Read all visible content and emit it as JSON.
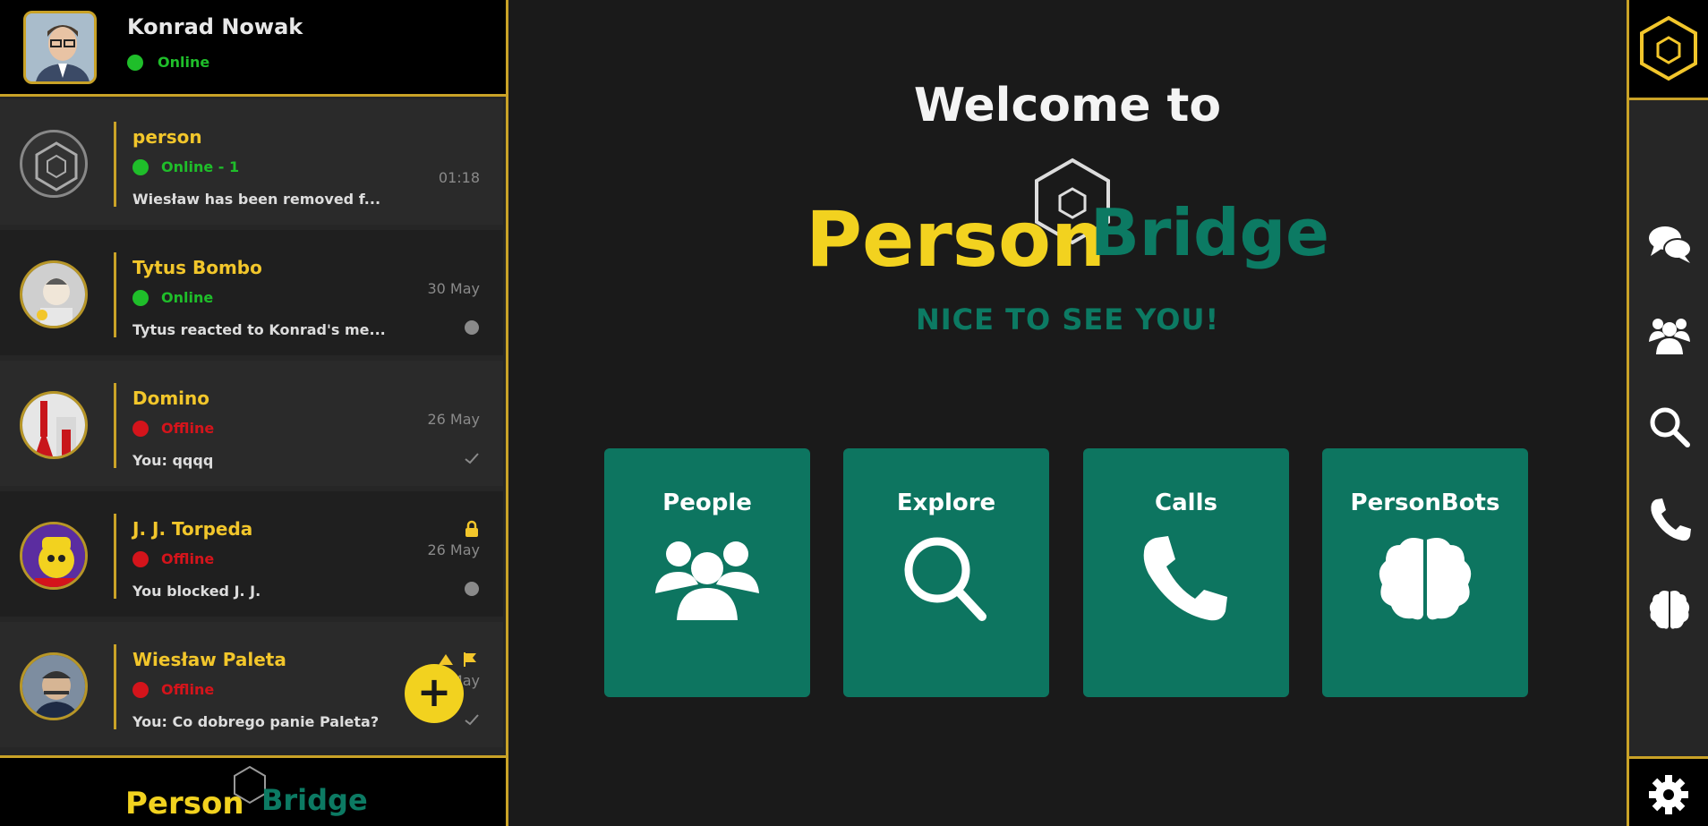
{
  "user": {
    "name": "Konrad Nowak",
    "status": "Online"
  },
  "chats": [
    {
      "name": "person",
      "status": "Online - 1",
      "status_color": "#1fbe2a",
      "message": "Wiesław has been removed f...",
      "time": "01:18"
    },
    {
      "name": "Tytus Bombo",
      "status": "Online",
      "status_color": "#1fbe2a",
      "message": "Tytus reacted to Konrad's me...",
      "time": "30 May"
    },
    {
      "name": "Domino",
      "status": "Offline",
      "status_color": "#d4141b",
      "message": "You: qqqq",
      "time": "26 May"
    },
    {
      "name": "J. J. Torpeda",
      "status": "Offline",
      "status_color": "#d4141b",
      "message": "You blocked J. J.",
      "time": "26 May"
    },
    {
      "name": "Wiesław Paleta",
      "status": "Offline",
      "status_color": "#d4141b",
      "message": "You: Co dobrego panie Paleta?",
      "time": "May"
    }
  ],
  "main": {
    "welcome": "Welcome to",
    "brand_left": "Person",
    "brand_right": "Bridge",
    "subtitle": "NICE TO SEE YOU!",
    "tiles": [
      {
        "label": "People",
        "icon": "users-icon"
      },
      {
        "label": "Explore",
        "icon": "search-icon"
      },
      {
        "label": "Calls",
        "icon": "phone-icon"
      },
      {
        "label": "PersonBots",
        "icon": "brain-icon"
      }
    ]
  },
  "footer": {
    "brand_left": "Person",
    "brand_right": "Bridge"
  },
  "right_nav": [
    "chat-icon",
    "users-icon",
    "search-icon",
    "phone-icon",
    "brain-icon",
    "gear-icon"
  ],
  "colors": {
    "gold": "#f2c62b",
    "border": "#c9a227",
    "teal": "#0d7560",
    "online": "#1fbe2a",
    "offline": "#d4141b"
  }
}
